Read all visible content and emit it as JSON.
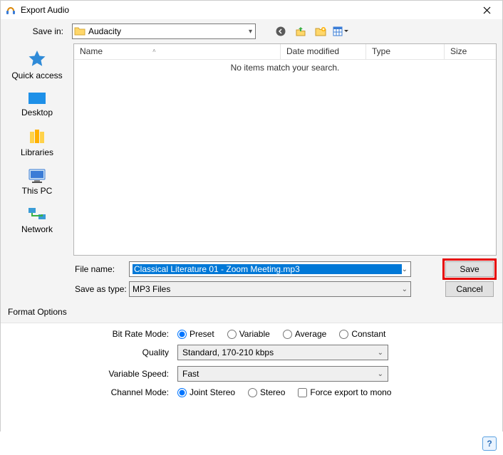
{
  "title": "Export Audio",
  "save_in": {
    "label": "Save in:",
    "value": "Audacity"
  },
  "columns": {
    "name": "Name",
    "date": "Date modified",
    "type": "Type",
    "size": "Size"
  },
  "empty_msg": "No items match your search.",
  "places": {
    "quick": "Quick access",
    "desktop": "Desktop",
    "libraries": "Libraries",
    "thispc": "This PC",
    "network": "Network"
  },
  "filename": {
    "label": "File name:",
    "value": "Classical Literature 01 - Zoom Meeting.mp3"
  },
  "saveastype": {
    "label": "Save as type:",
    "value": "MP3 Files"
  },
  "buttons": {
    "save": "Save",
    "cancel": "Cancel"
  },
  "section": "Format Options",
  "bitratemode": {
    "label": "Bit Rate Mode:",
    "options": {
      "preset": "Preset",
      "variable": "Variable",
      "average": "Average",
      "constant": "Constant"
    }
  },
  "quality": {
    "label": "Quality",
    "value": "Standard, 170-210 kbps"
  },
  "varspeed": {
    "label": "Variable Speed:",
    "value": "Fast"
  },
  "channelmode": {
    "label": "Channel Mode:",
    "options": {
      "joint": "Joint Stereo",
      "stereo": "Stereo"
    },
    "force": "Force export to mono"
  },
  "help": "?"
}
